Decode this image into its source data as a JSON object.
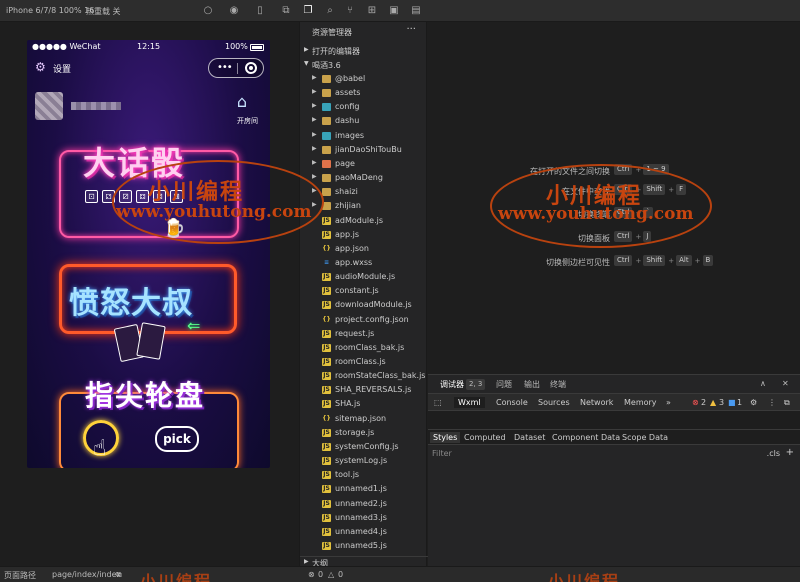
{
  "toolbar": {
    "device": "iPhone 6/7/8 100% 16",
    "hot_reload": "热重载 关"
  },
  "phone": {
    "carrier": "●●●●● WeChat",
    "time": "12:15",
    "battery": "100%",
    "settings_label": "设置",
    "room_label": "开房间",
    "card1_title": "大话骰",
    "card2_title": "愤怒大叔",
    "card3_title": "指尖轮盘",
    "pick_label": "pick",
    "dice": [
      "⚀",
      "⚁",
      "⚂",
      "⚃",
      "⚄",
      "⚅"
    ]
  },
  "explorer": {
    "title": "资源管理器",
    "open_editors": "打开的编辑器",
    "project": "喝酒3.6",
    "outline": "大纲",
    "items": [
      {
        "label": "@babel",
        "type": "folder"
      },
      {
        "label": "assets",
        "type": "folder"
      },
      {
        "label": "config",
        "type": "folder-teal"
      },
      {
        "label": "dashu",
        "type": "folder"
      },
      {
        "label": "images",
        "type": "folder-teal"
      },
      {
        "label": "jianDaoShiTouBu",
        "type": "folder"
      },
      {
        "label": "page",
        "type": "folder-orange"
      },
      {
        "label": "paoMaDeng",
        "type": "folder"
      },
      {
        "label": "shaizi",
        "type": "folder"
      },
      {
        "label": "zhijian",
        "type": "folder"
      },
      {
        "label": "adModule.js",
        "type": "js"
      },
      {
        "label": "app.js",
        "type": "js"
      },
      {
        "label": "app.json",
        "type": "json"
      },
      {
        "label": "app.wxss",
        "type": "wxss"
      },
      {
        "label": "audioModule.js",
        "type": "js"
      },
      {
        "label": "constant.js",
        "type": "js"
      },
      {
        "label": "downloadModule.js",
        "type": "js"
      },
      {
        "label": "project.config.json",
        "type": "json"
      },
      {
        "label": "request.js",
        "type": "js"
      },
      {
        "label": "roomClass_bak.js",
        "type": "js"
      },
      {
        "label": "roomClass.js",
        "type": "js"
      },
      {
        "label": "roomStateClass_bak.js",
        "type": "js"
      },
      {
        "label": "SHA_REVERSALS.js",
        "type": "js"
      },
      {
        "label": "SHA.js",
        "type": "js"
      },
      {
        "label": "sitemap.json",
        "type": "json"
      },
      {
        "label": "storage.js",
        "type": "js"
      },
      {
        "label": "systemConfig.js",
        "type": "js"
      },
      {
        "label": "systemLog.js",
        "type": "js"
      },
      {
        "label": "tool.js",
        "type": "js"
      },
      {
        "label": "unnamed1.js",
        "type": "js"
      },
      {
        "label": "unnamed2.js",
        "type": "js"
      },
      {
        "label": "unnamed3.js",
        "type": "js"
      },
      {
        "label": "unnamed4.js",
        "type": "js"
      },
      {
        "label": "unnamed5.js",
        "type": "js"
      }
    ]
  },
  "shortcuts": [
    {
      "label": "在打开的文件之间切换",
      "keys": [
        "Ctrl",
        "1 ~ 9"
      ]
    },
    {
      "label": "在文件中查找",
      "keys": [
        "Ctrl",
        "Shift",
        "F"
      ]
    },
    {
      "label": "切换终端",
      "keys": [
        "Ctrl",
        "`"
      ]
    },
    {
      "label": "切换面板",
      "keys": [
        "Ctrl",
        "J"
      ]
    },
    {
      "label": "切换侧边栏可见性",
      "keys": [
        "Ctrl",
        "Shift",
        "Alt",
        "B"
      ]
    }
  ],
  "watermark": {
    "cn": "小川编程",
    "url": "www.youhutong.com"
  },
  "devtools": {
    "tabs": [
      "调试器",
      "问题",
      "输出",
      "终端"
    ],
    "debugger_badge": "2, 3",
    "subtabs": [
      "Wxml",
      "Console",
      "Sources",
      "Network",
      "Memory"
    ],
    "more": "»",
    "errors": "2",
    "warnings": "3",
    "infos": "1",
    "style_tabs": [
      "Styles",
      "Computed",
      "Dataset",
      "Component Data",
      "Scope Data"
    ],
    "filter_placeholder": "Filter",
    "cls": ".cls",
    "plus": "+"
  },
  "statusbar": {
    "path_label": "页面路径",
    "path": "page/index/index",
    "errors": "0",
    "warnings": "0"
  }
}
